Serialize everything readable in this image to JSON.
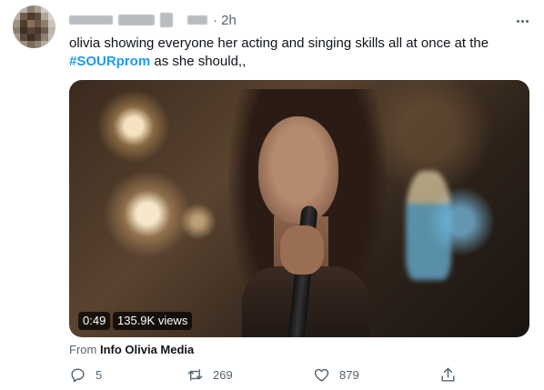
{
  "tweet": {
    "time": "· 2h",
    "text_before": "olivia showing everyone her acting and singing skills all at once at the ",
    "hashtag": "#SOURprom",
    "text_after": " as she should,,"
  },
  "video": {
    "duration": "0:49",
    "views": "135.9K views"
  },
  "source": {
    "prefix": "From ",
    "name": "Info Olivia Media"
  },
  "actions": {
    "reply_count": "5",
    "retweet_count": "269",
    "like_count": "879"
  },
  "icons": [
    "reply-icon",
    "retweet-icon",
    "like-icon",
    "share-icon",
    "more-icon"
  ],
  "colors": {
    "accent": "#1d9bf0",
    "secondary_text": "#536471"
  }
}
